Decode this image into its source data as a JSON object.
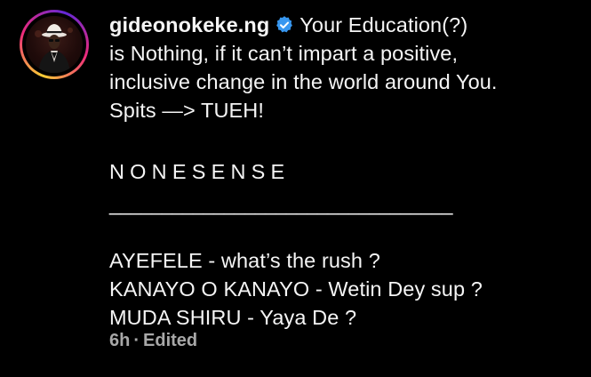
{
  "comment": {
    "username": "gideonokeke.ng",
    "verified_icon": "verified-badge-icon",
    "verified_color": "#3797f0",
    "lines": [
      "Your Education(?)",
      "is Nothing, if it can’t impart a positive,",
      "inclusive change in the world around You.",
      "Spits —> TUEH!",
      "NONESENSE",
      "_________________________________",
      "AYEFELE - what’s the rush ?",
      "KANAYO O KANAYO - Wetin Dey sup ?",
      "MUDA SHIRU - Yaya De ?"
    ],
    "meta": {
      "time": "6h",
      "separator": "·",
      "edited": "Edited"
    }
  },
  "avatar": {
    "icon": "profile-avatar-icon",
    "ring_colors": [
      "#f9ce34",
      "#ee2a7b",
      "#6228d7"
    ]
  }
}
